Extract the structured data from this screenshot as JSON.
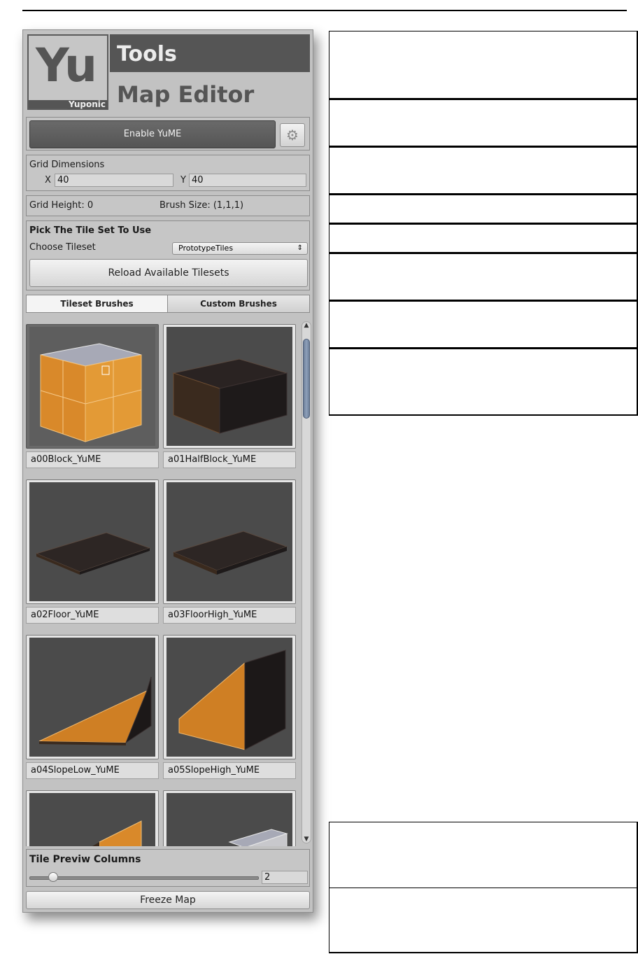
{
  "logo": {
    "yu": "Yu",
    "subtitle": "Yuponic",
    "tools": "Tools",
    "map_editor": "Map Editor"
  },
  "enable": {
    "label": "Enable YuME",
    "settings_icon": "gears-icon"
  },
  "grid": {
    "title": "Grid Dimensions",
    "x_label": "X",
    "x_value": "40",
    "y_label": "Y",
    "y_value": "40"
  },
  "status": {
    "grid_height": "Grid Height: 0",
    "brush_size": "Brush Size: (1,1,1)"
  },
  "tileset": {
    "heading": "Pick The Tile Set To Use",
    "choose_label": "Choose Tileset",
    "selected": "PrototypeTiles",
    "reload_label": "Reload Available Tilesets"
  },
  "tabs": [
    {
      "label": "Tileset Brushes",
      "active": true
    },
    {
      "label": "Custom Brushes",
      "active": false
    }
  ],
  "tiles": [
    {
      "name": "a00Block_YuME",
      "selected": true
    },
    {
      "name": "a01HalfBlock_YuME"
    },
    {
      "name": "a02Floor_YuME"
    },
    {
      "name": "a03FloorHigh_YuME"
    },
    {
      "name": "a04SlopeLow_YuME"
    },
    {
      "name": "a05SlopeHigh_YuME"
    },
    {
      "name": ""
    },
    {
      "name": ""
    }
  ],
  "columns": {
    "label": "Tile Previw Columns",
    "value": "2",
    "slider_fraction": 0.1
  },
  "freeze": {
    "label": "Freeze Map"
  },
  "colors": {
    "tile_orange": "#d9892a",
    "panel_bg": "#c2c2c2",
    "selection_blue": "#7f93b0"
  }
}
